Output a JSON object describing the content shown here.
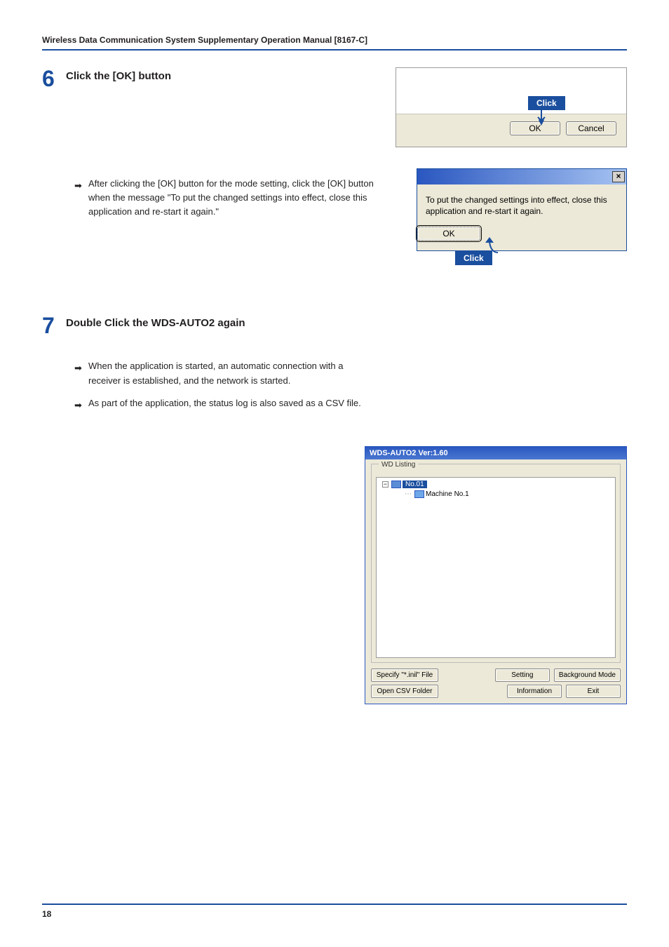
{
  "header": "Wireless Data Communication System Supplementary Operation Manual [8167-C]",
  "step6": {
    "num": "6",
    "title": "Click the [OK] button",
    "bullet": "After clicking the [OK] button for the mode setting, click the [OK] button when the message \"To put the changed settings into effect, close this application and re-start it again.\"",
    "dlg_ok": "OK",
    "dlg_cancel": "Cancel",
    "click_label": "Click"
  },
  "msgdlg": {
    "text": "To put the changed settings into effect, close this application and re-start it again.",
    "ok": "OK",
    "close_glyph": "×",
    "click_label": "Click"
  },
  "step7": {
    "num": "7",
    "title": "Double Click the WDS-AUTO2 again",
    "bullet1": "When the application is started, an automatic connection with a receiver is established, and the network is started.",
    "bullet2": "As part of the application, the status log is also saved as a CSV file."
  },
  "appwin": {
    "title": "WDS-AUTO2 Ver:1.60",
    "group": "WD Listing",
    "node_root": "No.01",
    "node_child": "Machine No.1",
    "expander": "−",
    "buttons": {
      "specify": "Specify \"*.inil\" File",
      "opencsv": "Open CSV Folder",
      "setting": "Setting",
      "info": "Information",
      "bgmode": "Background Mode",
      "exit": "Exit"
    }
  },
  "page_number": "18"
}
